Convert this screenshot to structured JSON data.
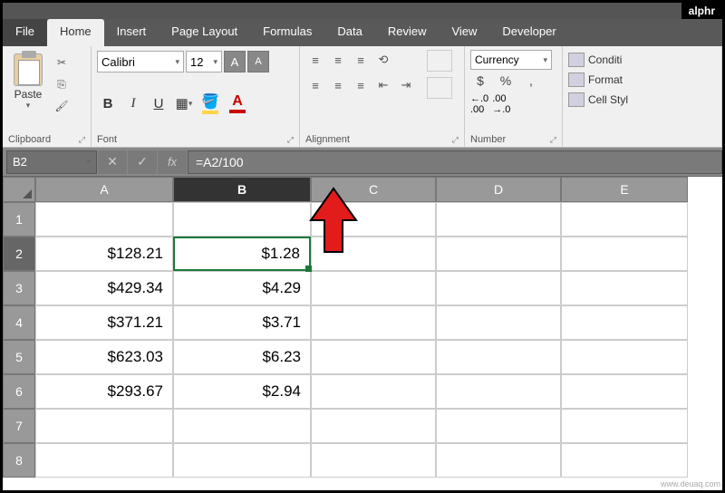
{
  "brand": "alphr",
  "watermark": "www.deuaq.com",
  "tabs": [
    "File",
    "Home",
    "Insert",
    "Page Layout",
    "Formulas",
    "Data",
    "Review",
    "View",
    "Developer"
  ],
  "active_tab": "Home",
  "clipboard": {
    "paste": "Paste",
    "label": "Clipboard"
  },
  "font": {
    "name": "Calibri",
    "size": "12",
    "label": "Font",
    "btns": {
      "bold": "B",
      "italic": "I",
      "underline": "U"
    }
  },
  "alignment": {
    "label": "Alignment"
  },
  "number": {
    "format": "Currency",
    "label": "Number",
    "dollar": "$",
    "percent": "%",
    "comma": ",",
    "dec1": ".0 .00",
    "dec2": ".00 .0"
  },
  "styles": {
    "cond": "Conditi",
    "fmt": "Format",
    "cell": "Cell Styl"
  },
  "name_box": "B2",
  "formula": "=A2/100",
  "columns": [
    "A",
    "B",
    "C",
    "D",
    "E"
  ],
  "selected_col": "B",
  "selected_row": 2,
  "rows": [
    {
      "n": 1,
      "A": "",
      "B": ""
    },
    {
      "n": 2,
      "A": "$128.21",
      "B": "$1.28"
    },
    {
      "n": 3,
      "A": "$429.34",
      "B": "$4.29"
    },
    {
      "n": 4,
      "A": "$371.21",
      "B": "$3.71"
    },
    {
      "n": 5,
      "A": "$623.03",
      "B": "$6.23"
    },
    {
      "n": 6,
      "A": "$293.67",
      "B": "$2.94"
    },
    {
      "n": 7,
      "A": "",
      "B": ""
    },
    {
      "n": 8,
      "A": "",
      "B": ""
    }
  ]
}
